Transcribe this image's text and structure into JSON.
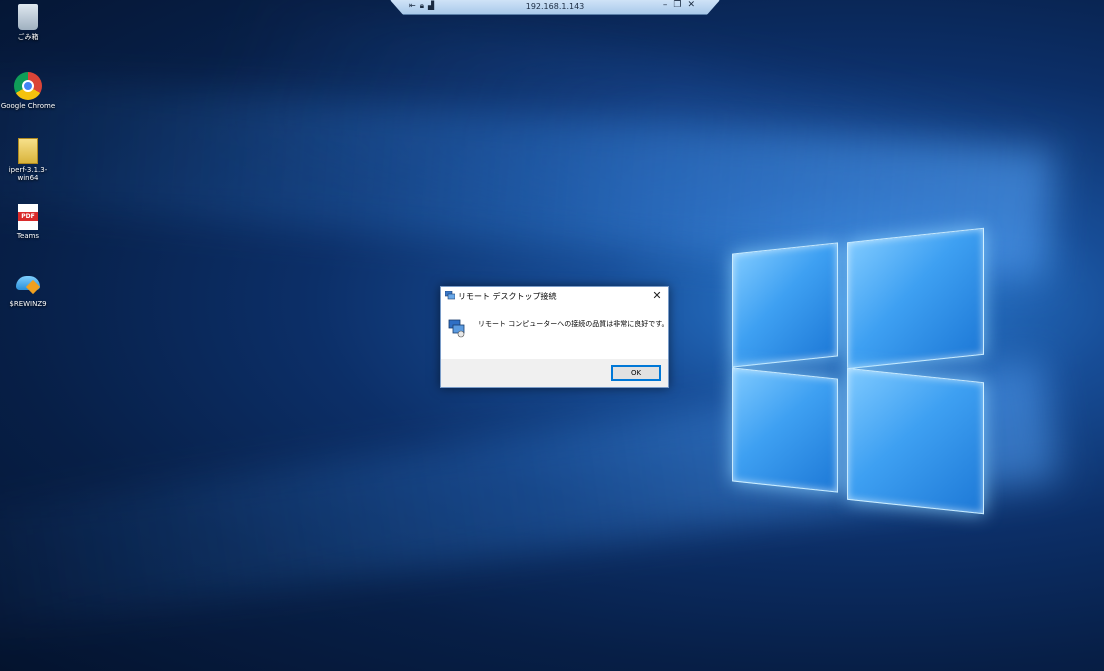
{
  "remote_bar": {
    "ip": "192.168.1.143",
    "left_icons": [
      "pin-icon",
      "lock-icon",
      "signal-icon"
    ],
    "right_icons": [
      "minimize-icon",
      "restore-icon",
      "close-icon"
    ]
  },
  "desktop_icons": [
    {
      "label": "ごみ箱",
      "icon": "recycle-bin-icon"
    },
    {
      "label": "Google Chrome",
      "icon": "chrome-icon"
    },
    {
      "label": "iperf-3.1.3-win64",
      "icon": "zip-folder-icon"
    },
    {
      "label": "Teams",
      "icon": "pdf-icon",
      "badge": "PDF"
    },
    {
      "label": "$REWINZ9",
      "icon": "rewinz-icon"
    }
  ],
  "dialog": {
    "title": "リモート デスクトップ接続",
    "message": "リモート コンピューターへの接続の品質は非常に良好です。",
    "ok_label": "OK",
    "close_glyph": "✕"
  },
  "colors": {
    "accent": "#0078d7",
    "wallpaper_dark": "#071f47",
    "wallpaper_light": "#2c7fd6"
  }
}
